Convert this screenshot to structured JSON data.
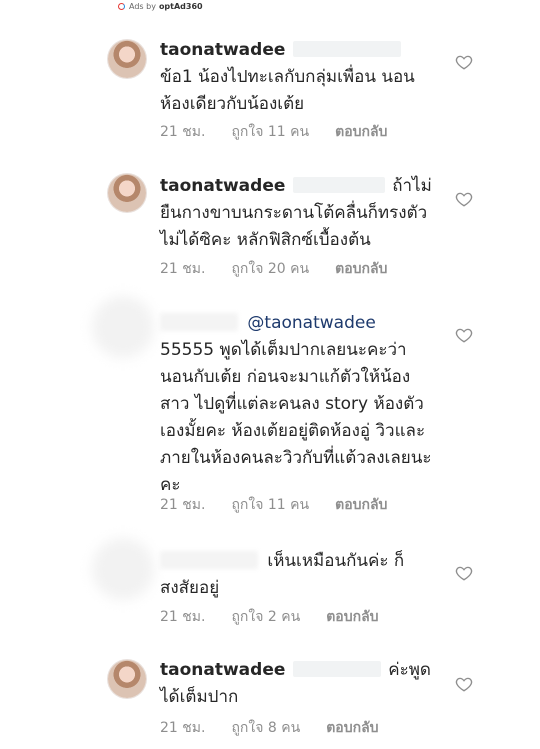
{
  "ads": {
    "prefix": "Ads by",
    "brand": "optAd360"
  },
  "comments": [
    {
      "username": "taonatwadee",
      "mention": "",
      "text": "ข้อ1 น้องไปทะเลกับกลุ่มเพื่อน นอนห้องเดียวกับน้องเต้ย",
      "time": "21 ชม.",
      "likes": "ถูกใจ 11 คน",
      "reply": "ตอบกลับ"
    },
    {
      "username": "taonatwadee",
      "mention": "",
      "text": "ถ้าไม่ยืนกางขาบนกระดานโต้คลื่นก็ทรงตัวไม่ได้ซิคะ หลักฟิสิกซ์เบื้องต้น",
      "time": "21 ชม.",
      "likes": "ถูกใจ 20 คน",
      "reply": "ตอบกลับ"
    },
    {
      "username": "",
      "mention": "@taonatwadee",
      "text": "55555 พูดได้เต็มปากเลยนะคะว่านอนกับเต้ย ก่อนจะมาแก้ตัวให้น้องสาว ไปดูที่แต่ละคนลง story ห้องตัวเองมั้ยคะ ห้องเต้ยอยู่ติดห้องอู่ วิวและภายในห้องคนละวิวกับที่แต้วลงเลยนะคะ",
      "time": "21 ชม.",
      "likes": "ถูกใจ 11 คน",
      "reply": "ตอบกลับ"
    },
    {
      "username": "",
      "mention": "",
      "text": "เห็นเหมือนกันค่ะ ก็สงสัยอยู่",
      "time": "21 ชม.",
      "likes": "ถูกใจ 2 คน",
      "reply": "ตอบกลับ"
    },
    {
      "username": "taonatwadee",
      "mention": "",
      "text": "ค่ะพูดได้เต็มปาก",
      "time": "21 ชม.",
      "likes": "ถูกใจ 8 คน",
      "reply": "ตอบกลับ"
    }
  ]
}
